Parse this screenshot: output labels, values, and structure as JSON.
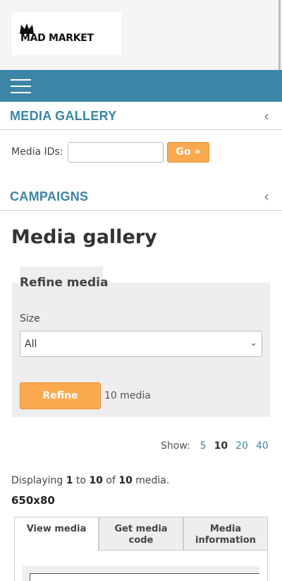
{
  "brand": {
    "logo_text": "MAD MARKET"
  },
  "nav": {
    "menu_icon": "hamburger-icon"
  },
  "sections": {
    "media_gallery": {
      "title": "MEDIA GALLERY",
      "chevron": "‹"
    },
    "campaigns": {
      "title": "CAMPAIGNS",
      "chevron": "‹"
    }
  },
  "media_ids": {
    "label": "Media IDs:",
    "value": "",
    "go_label": "Go »"
  },
  "page": {
    "title": "Media gallery"
  },
  "refine": {
    "title": "Refine media",
    "size_label": "Size",
    "size_selected": "All",
    "button_label": "Refine",
    "count_text": "10 media"
  },
  "pagination": {
    "show_label": "Show:",
    "options": [
      "5",
      "10",
      "20",
      "40"
    ],
    "current": "10"
  },
  "displaying": {
    "prefix": "Displaying",
    "from": "1",
    "to_word": "to",
    "to": "10",
    "of_word": "of",
    "total": "10",
    "suffix": "media."
  },
  "media_size": "650x80",
  "tabs": [
    {
      "line1": "View media",
      "line2": ""
    },
    {
      "line1": "Get media",
      "line2": "code"
    },
    {
      "line1": "Media",
      "line2": "information"
    }
  ],
  "colors": {
    "accent": "#3b86a6",
    "button": "#fba94f",
    "panel": "#eeeeee"
  }
}
